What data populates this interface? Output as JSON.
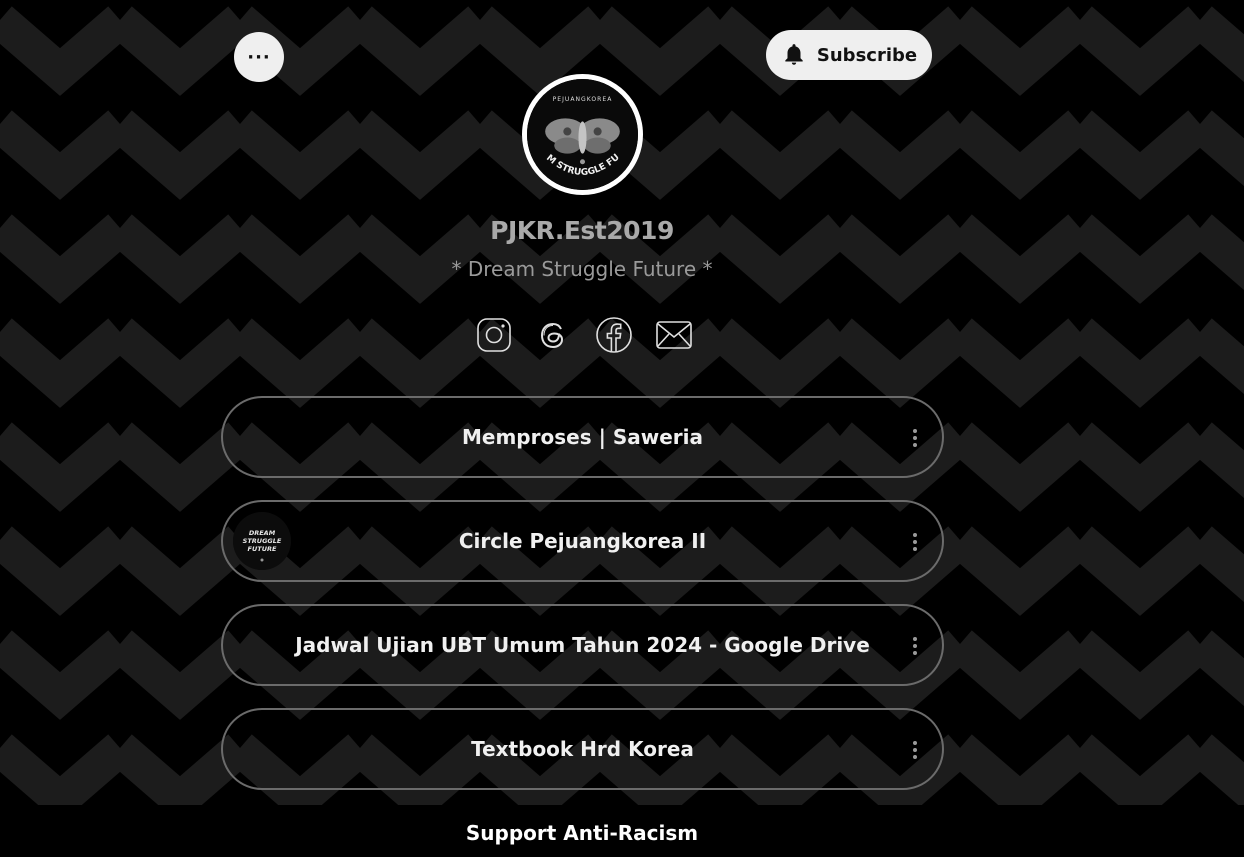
{
  "header": {
    "more_label": "···",
    "subscribe_label": "Subscribe"
  },
  "profile": {
    "name": "PJKR.Est2019",
    "bio": "* Dream Struggle Future *",
    "avatar_text_top": "PEJUANGKOREA",
    "avatar_text_bottom": "DREAM STRUGGLE FUTURE"
  },
  "socials": [
    {
      "icon": "instagram-icon"
    },
    {
      "icon": "threads-icon"
    },
    {
      "icon": "facebook-icon"
    },
    {
      "icon": "email-icon"
    }
  ],
  "links": [
    {
      "label": "Memproses | Saweria"
    },
    {
      "label": "Circle Pejuangkorea II",
      "thumb_lines": [
        "DREAM",
        "STRUGGLE",
        "FUTURE"
      ]
    },
    {
      "label": "Jadwal Ujian UBT Umum Tahun 2024 - Google Drive"
    },
    {
      "label": "Textbook Hrd Korea"
    }
  ],
  "footer": {
    "label": "Support Anti-Racism"
  },
  "colors": {
    "background": "#000000",
    "zigzag": "#1c1c1c",
    "button_bg": "#efefef",
    "card_border": "#6b6b6b"
  }
}
